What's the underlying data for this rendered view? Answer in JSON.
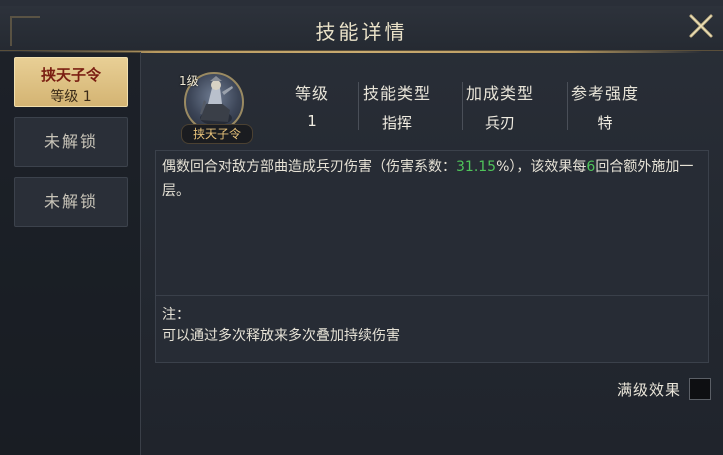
{
  "title": "技能详情",
  "sidebar": {
    "active_skill": {
      "name": "挟天子令",
      "level": "等级 1"
    },
    "locked": [
      "未解锁",
      "未解锁"
    ]
  },
  "skill": {
    "level_badge": "1级",
    "name_label": "挟天子令"
  },
  "stats": [
    {
      "header": "等级",
      "value": "1"
    },
    {
      "header": "技能类型",
      "value": "指挥"
    },
    {
      "header": "加成类型",
      "value": "兵刃"
    },
    {
      "header": "参考强度",
      "value": "特"
    }
  ],
  "description": {
    "part1": "偶数回合对敌方部曲造成兵刃伤害（伤害系数：",
    "coef": "31.15",
    "part2": "%），该效果每",
    "rounds": "6",
    "part3": "回合额外施加一层。"
  },
  "note": {
    "title": "注：",
    "text": "可以通过多次释放来多次叠加持续伤害"
  },
  "max_level": {
    "label": "满级效果"
  },
  "colors": {
    "highlight": "#4fc45a",
    "gold": "#d4b473",
    "accent_red": "#7a1e12"
  }
}
